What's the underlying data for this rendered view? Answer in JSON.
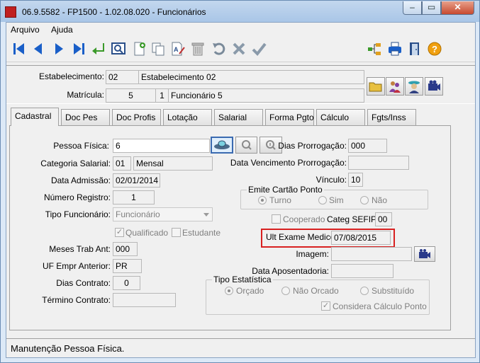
{
  "window": {
    "title": "06.9.5582 - FP1500 - 1.02.08.020 - Funcionários",
    "minimize": "–",
    "maximize": "▭",
    "close": "✕"
  },
  "menu": {
    "arquivo": "Arquivo",
    "ajuda": "Ajuda"
  },
  "toolbar": {
    "left_icons": [
      "first-record-icon",
      "previous-record-icon",
      "next-record-icon",
      "last-record-icon",
      "enter-icon",
      "preview-icon",
      "new-document-icon",
      "copy-icon",
      "edit-document-icon",
      "delete-icon",
      "undo-icon",
      "cancel-icon",
      "confirm-icon"
    ],
    "right_icons": [
      "tree-icon",
      "print-icon",
      "exit-door-icon",
      "help-icon"
    ],
    "help_glyph": "?"
  },
  "header": {
    "estabelecimento_label": "Estabelecimento:",
    "estabelecimento_code": "02",
    "estabelecimento_name": "Estabelecimento 02",
    "matricula_label": "Matrícula:",
    "matricula_code": "5",
    "matricula_seq": "1",
    "matricula_name": "Funcionário 5"
  },
  "tabs": [
    "Cadastral",
    "Doc Pes",
    "Doc Profis",
    "Lotação",
    "Salarial",
    "Forma Pgto",
    "Cálculo",
    "Fgts/Inss"
  ],
  "active_tab": "Cadastral",
  "form": {
    "pessoa_fisica_label": "Pessoa Física:",
    "pessoa_fisica_value": "6",
    "categoria_salarial_label": "Categoria Salarial:",
    "categoria_salarial_code": "01",
    "categoria_salarial_name": "Mensal",
    "data_admissao_label": "Data Admissão:",
    "data_admissao_value": "02/01/2014",
    "numero_registro_label": "Número Registro:",
    "numero_registro_value": "1",
    "tipo_funcionario_label": "Tipo Funcionário:",
    "tipo_funcionario_value": "Funcionário",
    "qualificado_label": "Qualificado",
    "estudante_label": "Estudante",
    "meses_trab_ant_label": "Meses Trab Ant:",
    "meses_trab_ant_value": "000",
    "uf_empr_anterior_label": "UF Empr Anterior:",
    "uf_empr_anterior_value": "PR",
    "dias_contrato_label": "Dias Contrato:",
    "dias_contrato_value": "0",
    "termino_contrato_label": "Término Contrato:",
    "termino_contrato_value": "",
    "dias_prorrogacao_label": "Dias Prorrogação:",
    "dias_prorrogacao_value": "000",
    "data_venc_prorrogacao_label": "Data Vencimento Prorrogação:",
    "data_venc_prorrogacao_value": "",
    "vinculo_label": "Vínculo:",
    "vinculo_value": "10",
    "emite_cartao_ponto_label": "Emite Cartão Ponto",
    "cartao_options": [
      "Turno",
      "Sim",
      "Não"
    ],
    "cartao_selected": "Turno",
    "cooperado_label": "Cooperado",
    "categ_sefip_label": "Categ SEFIP:",
    "categ_sefip_value": "00",
    "ult_exame_medico_label": "Ult Exame Medico:",
    "ult_exame_medico_value": "07/08/2015",
    "imagem_label": "Imagem:",
    "imagem_value": "",
    "data_aposentadoria_label": "Data Aposentadoria:",
    "data_aposentadoria_value": "",
    "tipo_estatistica_label": "Tipo Estatística",
    "estatistica_options": [
      "Orçado",
      "Não Orcado",
      "Substituído"
    ],
    "estatistica_selected": "Orçado",
    "considera_calculo_ponto_label": "Considera Cálculo Ponto"
  },
  "status": {
    "text": "Manutenção Pessoa Física."
  },
  "colors": {
    "highlight": "#d82020",
    "titlebar": "#b4cdea",
    "nav_blue": "#1a5fc8",
    "close_red": "#c74a30"
  }
}
